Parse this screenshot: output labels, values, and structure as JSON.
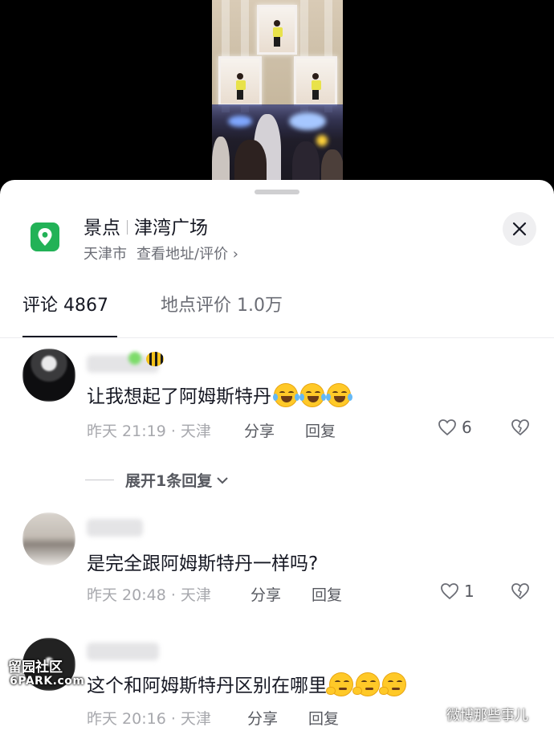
{
  "location": {
    "category": "景点",
    "name": "津湾广场",
    "city": "天津市",
    "link_text": "查看地址/评价 ›"
  },
  "tabs": [
    {
      "label": "评论 4867"
    },
    {
      "label": "地点评价 1.0万"
    }
  ],
  "comments": [
    {
      "text": "让我想起了阿姆斯特丹",
      "emojis": [
        "tears-of-joy",
        "tears-of-joy",
        "tears-of-joy"
      ],
      "meta": "昨天 21:19 · 天津",
      "share": "分享",
      "reply": "回复",
      "likes": "6"
    },
    {
      "text": "是完全跟阿姆斯特丹一样吗?",
      "meta": "昨天 20:48 · 天津",
      "share": "分享",
      "reply": "回复",
      "likes": "1"
    },
    {
      "text": "这个和阿姆斯特丹区别在哪里",
      "emojis": [
        "thinking-smirk",
        "thinking-smirk",
        "thinking-smirk"
      ],
      "meta": "昨天 20:16 · 天津",
      "share": "分享",
      "reply": "回复"
    }
  ],
  "expand_replies": "展开1条回复",
  "watermarks": {
    "left_line1": "留园社区",
    "left_line2": "6PARK.com",
    "right": "微博那些事儿"
  },
  "colors": {
    "location_icon": "#22b257",
    "text_primary": "#161823",
    "text_secondary": "#a7a8ad"
  }
}
